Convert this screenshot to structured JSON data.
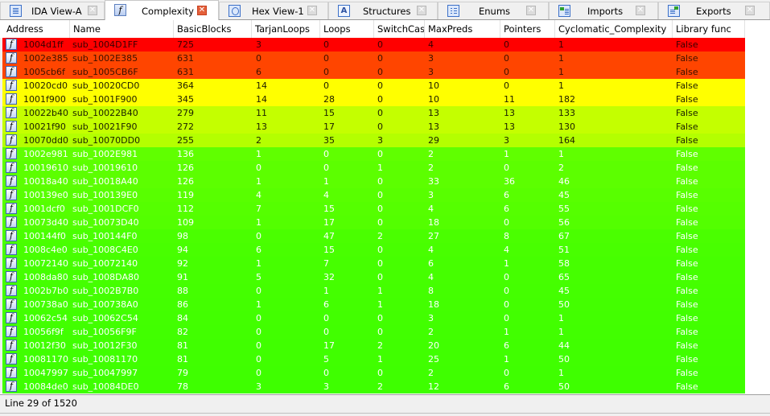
{
  "tabs": [
    {
      "label": "IDA View-A",
      "icon": "disassembly-icon",
      "active": false
    },
    {
      "label": "Complexity",
      "icon": "function-icon",
      "active": true
    },
    {
      "label": "Hex View-1",
      "icon": "hex-view-icon",
      "active": false
    },
    {
      "label": "Structures",
      "icon": "structures-icon",
      "active": false
    },
    {
      "label": "Enums",
      "icon": "enums-icon",
      "active": false
    },
    {
      "label": "Imports",
      "icon": "imports-icon",
      "active": false
    },
    {
      "label": "Exports",
      "icon": "exports-icon",
      "active": false
    }
  ],
  "close_glyph": "✕",
  "function_glyph": "f",
  "table": {
    "columns": [
      "Address",
      "Name",
      "BasicBlocks",
      "TarjanLoops",
      "Loops",
      "SwitchCases",
      "MaxPreds",
      "Pointers",
      "Cyclomatic_Complexity",
      "Library func"
    ],
    "rows": [
      {
        "cells": [
          "1004d1ff",
          "sub_1004D1FF",
          "725",
          "3",
          "0",
          "0",
          "4",
          "0",
          "1",
          "False"
        ],
        "bg": "#ff0000",
        "fg": "#3a0000"
      },
      {
        "cells": [
          "1002e385",
          "sub_1002E385",
          "631",
          "0",
          "0",
          "0",
          "3",
          "0",
          "1",
          "False"
        ],
        "bg": "#ff4500",
        "fg": "#3a1000"
      },
      {
        "cells": [
          "1005cb6f",
          "sub_1005CB6F",
          "631",
          "6",
          "0",
          "0",
          "3",
          "0",
          "1",
          "False"
        ],
        "bg": "#ff4500",
        "fg": "#3a1000"
      },
      {
        "cells": [
          "10020cd0",
          "sub_10020CD0",
          "364",
          "14",
          "0",
          "0",
          "10",
          "0",
          "1",
          "False"
        ],
        "bg": "#ffff00",
        "fg": "#202000"
      },
      {
        "cells": [
          "1001f900",
          "sub_1001F900",
          "345",
          "14",
          "28",
          "0",
          "10",
          "11",
          "182",
          "False"
        ],
        "bg": "#ffff00",
        "fg": "#202000"
      },
      {
        "cells": [
          "10022b40",
          "sub_10022B40",
          "279",
          "11",
          "15",
          "0",
          "13",
          "13",
          "133",
          "False"
        ],
        "bg": "#c4ff00",
        "fg": "#1a2000"
      },
      {
        "cells": [
          "10021f90",
          "sub_10021F90",
          "272",
          "13",
          "17",
          "0",
          "13",
          "13",
          "130",
          "False"
        ],
        "bg": "#c4ff00",
        "fg": "#1a2000"
      },
      {
        "cells": [
          "10070dd0",
          "sub_10070DD0",
          "255",
          "2",
          "35",
          "3",
          "29",
          "3",
          "164",
          "False"
        ],
        "bg": "#b4ff00",
        "fg": "#1a2000"
      },
      {
        "cells": [
          "1002e981",
          "sub_1002E981",
          "136",
          "1",
          "0",
          "0",
          "2",
          "1",
          "1",
          "False"
        ],
        "bg": "#60ff00",
        "fg": "#ffffff"
      },
      {
        "cells": [
          "10019610",
          "sub_10019610",
          "126",
          "0",
          "0",
          "1",
          "2",
          "0",
          "2",
          "False"
        ],
        "bg": "#5cff00",
        "fg": "#ffffff"
      },
      {
        "cells": [
          "10018a40",
          "sub_10018A40",
          "126",
          "1",
          "1",
          "0",
          "33",
          "36",
          "46",
          "False"
        ],
        "bg": "#5cff00",
        "fg": "#ffffff"
      },
      {
        "cells": [
          "100139e0",
          "sub_100139E0",
          "119",
          "4",
          "4",
          "0",
          "3",
          "6",
          "45",
          "False"
        ],
        "bg": "#58ff00",
        "fg": "#ffffff"
      },
      {
        "cells": [
          "1001dcf0",
          "sub_1001DCF0",
          "112",
          "7",
          "15",
          "0",
          "4",
          "6",
          "55",
          "False"
        ],
        "bg": "#55ff00",
        "fg": "#ffffff"
      },
      {
        "cells": [
          "10073d40",
          "sub_10073D40",
          "109",
          "1",
          "17",
          "0",
          "18",
          "0",
          "56",
          "False"
        ],
        "bg": "#53ff00",
        "fg": "#ffffff"
      },
      {
        "cells": [
          "100144f0",
          "sub_100144F0",
          "98",
          "0",
          "47",
          "2",
          "27",
          "8",
          "67",
          "False"
        ],
        "bg": "#4aff00",
        "fg": "#ffffff"
      },
      {
        "cells": [
          "1008c4e0",
          "sub_1008C4E0",
          "94",
          "6",
          "15",
          "0",
          "4",
          "4",
          "51",
          "False"
        ],
        "bg": "#48ff00",
        "fg": "#ffffff"
      },
      {
        "cells": [
          "10072140",
          "sub_10072140",
          "92",
          "1",
          "7",
          "0",
          "6",
          "1",
          "58",
          "False"
        ],
        "bg": "#46ff00",
        "fg": "#ffffff"
      },
      {
        "cells": [
          "1008da80",
          "sub_1008DA80",
          "91",
          "5",
          "32",
          "0",
          "4",
          "0",
          "65",
          "False"
        ],
        "bg": "#45ff00",
        "fg": "#ffffff"
      },
      {
        "cells": [
          "1002b7b0",
          "sub_1002B7B0",
          "88",
          "0",
          "1",
          "1",
          "8",
          "0",
          "45",
          "False"
        ],
        "bg": "#44ff00",
        "fg": "#ffffff"
      },
      {
        "cells": [
          "100738a0",
          "sub_100738A0",
          "86",
          "1",
          "6",
          "1",
          "18",
          "0",
          "50",
          "False"
        ],
        "bg": "#43ff00",
        "fg": "#ffffff"
      },
      {
        "cells": [
          "10062c54",
          "sub_10062C54",
          "84",
          "0",
          "0",
          "0",
          "3",
          "0",
          "1",
          "False"
        ],
        "bg": "#42ff00",
        "fg": "#ffffff"
      },
      {
        "cells": [
          "10056f9f",
          "sub_10056F9F",
          "82",
          "0",
          "0",
          "0",
          "2",
          "1",
          "1",
          "False"
        ],
        "bg": "#41ff00",
        "fg": "#ffffff"
      },
      {
        "cells": [
          "10012f30",
          "sub_10012F30",
          "81",
          "0",
          "17",
          "2",
          "20",
          "6",
          "44",
          "False"
        ],
        "bg": "#40ff00",
        "fg": "#ffffff"
      },
      {
        "cells": [
          "10081170",
          "sub_10081170",
          "81",
          "0",
          "5",
          "1",
          "25",
          "1",
          "50",
          "False"
        ],
        "bg": "#40ff00",
        "fg": "#ffffff"
      },
      {
        "cells": [
          "10047997",
          "sub_10047997",
          "79",
          "0",
          "0",
          "0",
          "2",
          "0",
          "1",
          "False"
        ],
        "bg": "#3fff00",
        "fg": "#ffffff"
      },
      {
        "cells": [
          "10084de0",
          "sub_10084DE0",
          "78",
          "3",
          "3",
          "2",
          "12",
          "6",
          "50",
          "False"
        ],
        "bg": "#3eff00",
        "fg": "#ffffff"
      }
    ]
  },
  "status": {
    "text": "Line 29 of 1520"
  }
}
